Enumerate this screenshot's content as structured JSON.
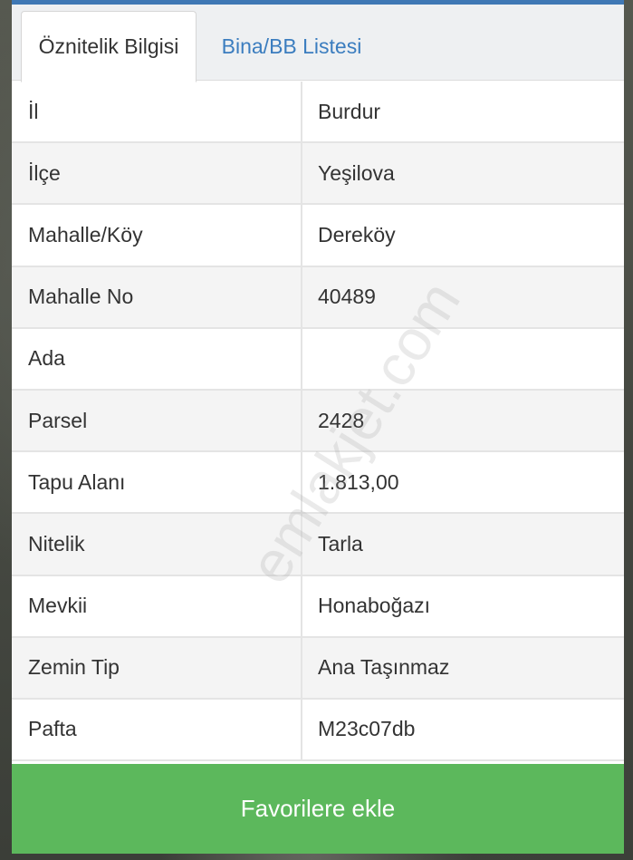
{
  "tabs": [
    {
      "label": "Öznitelik Bilgisi",
      "active": true
    },
    {
      "label": "Bina/BB Listesi",
      "active": false
    }
  ],
  "rows": [
    {
      "key": "İl",
      "value": "Burdur"
    },
    {
      "key": "İlçe",
      "value": "Yeşilova"
    },
    {
      "key": "Mahalle/Köy",
      "value": "Dereköy"
    },
    {
      "key": "Mahalle No",
      "value": "40489"
    },
    {
      "key": "Ada",
      "value": ""
    },
    {
      "key": "Parsel",
      "value": "2428"
    },
    {
      "key": "Tapu Alanı",
      "value": "1.813,00"
    },
    {
      "key": "Nitelik",
      "value": "Tarla"
    },
    {
      "key": "Mevkii",
      "value": "Honaboğazı"
    },
    {
      "key": "Zemin Tip",
      "value": "Ana Taşınmaz"
    },
    {
      "key": "Pafta",
      "value": "M23c07db"
    }
  ],
  "watermark": "emlakjet.com",
  "button": {
    "label": "Favorilere ekle"
  },
  "colors": {
    "accent": "#3f78b5",
    "tab_link": "#3b7dbf",
    "button_green": "#5cb85c"
  }
}
